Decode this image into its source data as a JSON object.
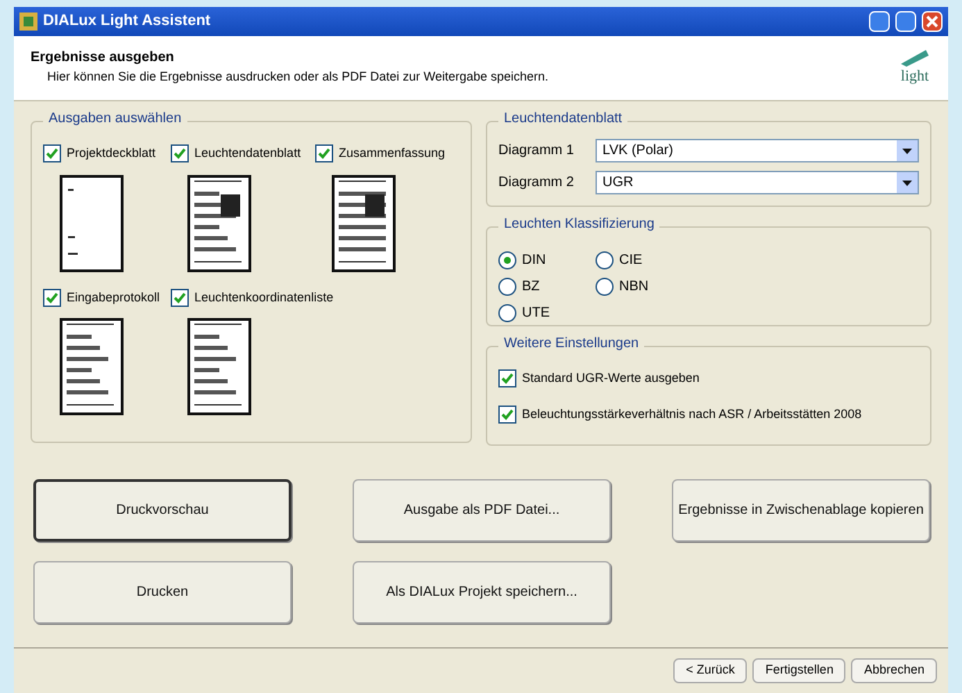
{
  "window": {
    "title": "DIALux Light Assistent"
  },
  "header": {
    "title": "Ergebnisse ausgeben",
    "subtitle": "Hier können Sie die Ergebnisse ausdrucken oder als PDF Datei zur Weitergabe speichern.",
    "logo": "light"
  },
  "outputs": {
    "title": "Ausgaben auswählen",
    "items": [
      {
        "label": "Projektdeckblatt",
        "checked": true
      },
      {
        "label": "Leuchtendatenblatt",
        "checked": true
      },
      {
        "label": "Zusammenfassung",
        "checked": true
      },
      {
        "label": "Eingabeprotokoll",
        "checked": true
      },
      {
        "label": "Leuchtenkoordinatenliste",
        "checked": true
      }
    ]
  },
  "datasheet": {
    "title": "Leuchtendatenblatt",
    "diagrams": [
      {
        "label": "Diagramm 1",
        "value": "LVK (Polar)"
      },
      {
        "label": "Diagramm 2",
        "value": "UGR"
      }
    ]
  },
  "classification": {
    "title": "Leuchten Klassifizierung",
    "options": [
      {
        "label": "DIN",
        "selected": true
      },
      {
        "label": "CIE",
        "selected": false
      },
      {
        "label": "BZ",
        "selected": false
      },
      {
        "label": "NBN",
        "selected": false
      },
      {
        "label": "UTE",
        "selected": false
      }
    ]
  },
  "settings": {
    "title": "Weitere Einstellungen",
    "items": [
      {
        "label": "Standard UGR-Werte ausgeben",
        "checked": true
      },
      {
        "label": "Beleuchtungsstärkeverhältnis nach ASR / Arbeitsstätten 2008",
        "checked": true
      }
    ]
  },
  "actions": [
    {
      "label": "Druckvorschau",
      "focused": true
    },
    {
      "label": "Ausgabe als PDF Datei...",
      "focused": false
    },
    {
      "label": "Ergebnisse in Zwischenablage kopieren",
      "focused": false
    },
    {
      "label": "Drucken",
      "focused": false
    },
    {
      "label": "Als DIALux Projekt speichern...",
      "focused": false
    }
  ],
  "footer_buttons": [
    "< Zurück",
    "Fertigstellen",
    "Abbrechen"
  ]
}
